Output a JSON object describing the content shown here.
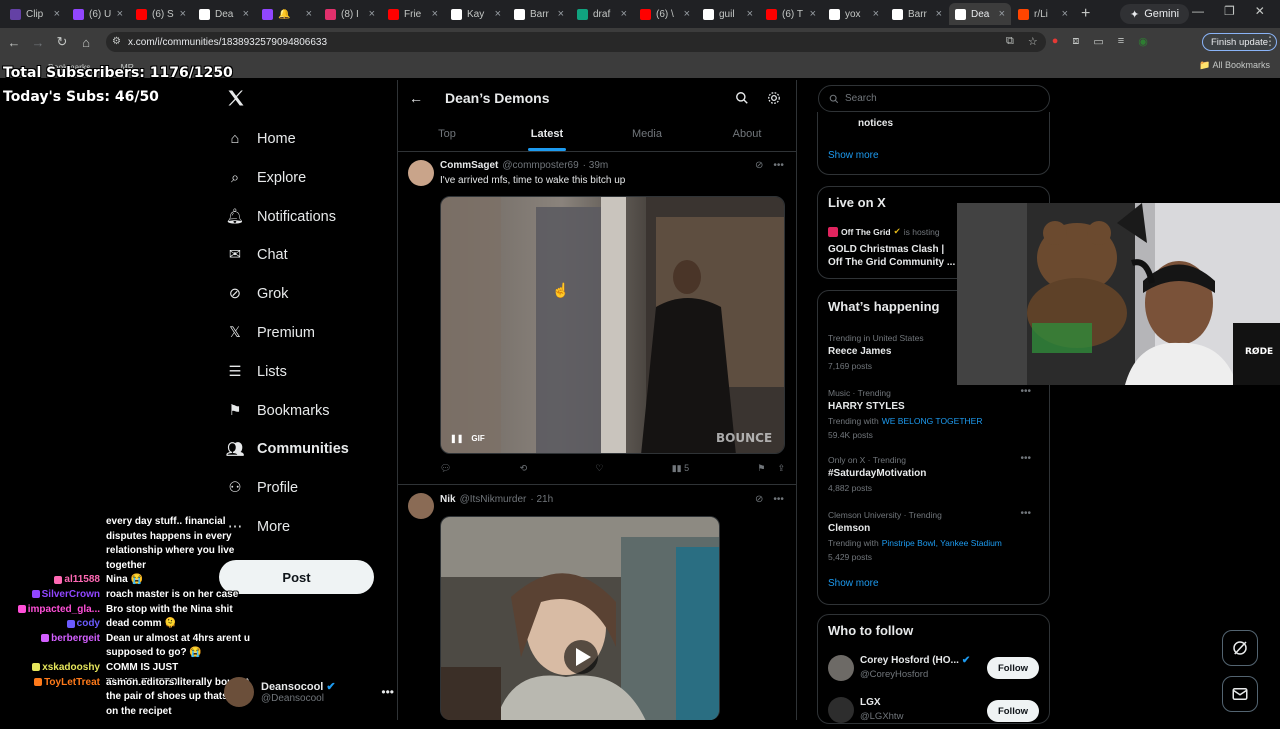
{
  "browser": {
    "tabs": [
      {
        "label": "Clip",
        "color": "#6441a5"
      },
      {
        "label": "(6) U",
        "color": "#9146ff"
      },
      {
        "label": "(6) S",
        "color": "#ff0000"
      },
      {
        "label": "Dea",
        "color": "#ffffff"
      },
      {
        "label": "🔔",
        "color": "#9146ff"
      },
      {
        "label": "(8) I",
        "color": "#e1306c"
      },
      {
        "label": "Frie",
        "color": "#ff0000"
      },
      {
        "label": "Kay",
        "color": "#ffffff"
      },
      {
        "label": "Barr",
        "color": "#ffffff"
      },
      {
        "label": "draf",
        "color": "#10a37f"
      },
      {
        "label": "(6) \\",
        "color": "#ff0000"
      },
      {
        "label": "guil",
        "color": "#ffffff"
      },
      {
        "label": "(6) T",
        "color": "#ff0000"
      },
      {
        "label": "yox",
        "color": "#ffffff"
      },
      {
        "label": "Barr",
        "color": "#ffffff"
      },
      {
        "label": "Dea",
        "color": "#ffffff",
        "active": true
      },
      {
        "label": "r/Li",
        "color": "#ff4500"
      }
    ],
    "gemini_label": "Gemini",
    "url": "x.com/i/communities/1838932579094806633",
    "update_label": "Finish update",
    "bookmarks_label": "Bookmarks",
    "bookmark_items": [
      "w",
      "MR"
    ],
    "all_bookmarks_label": "All Bookmarks"
  },
  "overlay": {
    "total_subs": "Total Subscribers: 1176/1250",
    "today_subs": "Today's Subs: 46/50"
  },
  "nav": {
    "items": [
      {
        "label": "Home",
        "icon": "home-icon"
      },
      {
        "label": "Explore",
        "icon": "search-icon"
      },
      {
        "label": "Notifications",
        "icon": "bell-icon"
      },
      {
        "label": "Chat",
        "icon": "mail-icon"
      },
      {
        "label": "Grok",
        "icon": "grok-icon"
      },
      {
        "label": "Premium",
        "icon": "x-icon"
      },
      {
        "label": "Lists",
        "icon": "list-icon"
      },
      {
        "label": "Bookmarks",
        "icon": "bookmark-icon"
      },
      {
        "label": "Communities",
        "icon": "people-icon",
        "active": true
      },
      {
        "label": "Profile",
        "icon": "person-icon"
      },
      {
        "label": "More",
        "icon": "more-circle-icon"
      }
    ],
    "post_label": "Post",
    "account_name": "Deansocool",
    "account_handle": "@Deansocool"
  },
  "chat": [
    {
      "user": "",
      "color": "#ffffff",
      "msg": "every day stuff.. financial"
    },
    {
      "user": "",
      "color": "#ffffff",
      "msg": "disputes happens in every"
    },
    {
      "user": "",
      "color": "#ffffff",
      "msg": "relationship where you live"
    },
    {
      "user": "",
      "color": "#ffffff",
      "msg": "together"
    },
    {
      "user": "al11588",
      "color": "#ff69b4",
      "msg": "Nina 😭"
    },
    {
      "user": "SilverCrown",
      "color": "#9146ff",
      "msg": "roach master is on her case"
    },
    {
      "user": "impacted_gla...",
      "color": "#ff4fd8",
      "msg": "Bro stop with the Nina shit"
    },
    {
      "user": "cody",
      "color": "#6b5bff",
      "msg": "dead comm 🫠"
    },
    {
      "user": "berbergeit",
      "color": "#d35fff",
      "msg": "Dean ur almost at 4hrs arent u"
    },
    {
      "user": "",
      "color": "#ffffff",
      "msg": "supposed to go? 😭"
    },
    {
      "user": "xskadooshy",
      "color": "#e6e65c",
      "msg": "COMM IS JUST TUMBLEWEEDS"
    },
    {
      "user": "ToyLetTreat",
      "color": "#ff7a1a",
      "msg": "asmon editors literally bought"
    },
    {
      "user": "",
      "color": "#ffffff",
      "msg": "the pair of shoes up thats not"
    },
    {
      "user": "",
      "color": "#ffffff",
      "msg": "on the recipet"
    }
  ],
  "community": {
    "title": "Dean’s Demons",
    "tabs": [
      "Top",
      "Latest",
      "Media",
      "About"
    ],
    "active_tab": "Latest"
  },
  "tweets": [
    {
      "name": "CommSaget",
      "handle": "@commposter69",
      "time": "· 39m",
      "text": "I've arrived mfs, time to wake this bitch up",
      "media_badge": "GIF",
      "watermark": "BOUNCE",
      "views": "5"
    },
    {
      "name": "Nik",
      "handle": "@ItsNikmurder",
      "time": "· 21h",
      "text": ""
    }
  ],
  "sidebar": {
    "search_placeholder": "Search",
    "notices_label": "notices",
    "show_more": "Show more",
    "live_title": "Live on X",
    "live_host": "Off The Grid",
    "live_hosting": "is hosting",
    "live_event": "GOLD Christmas Clash | Off The Grid Community ...",
    "happening_title": "What’s happening",
    "trends": [
      {
        "context": "Trending in United States",
        "name": "Reece James",
        "meta": "7,169 posts",
        "with": ""
      },
      {
        "context": "Music · Trending",
        "name": "HARRY STYLES",
        "meta": "59.4K posts",
        "with": "WE BELONG TOGETHER"
      },
      {
        "context": "Only on X · Trending",
        "name": "#SaturdayMotivation",
        "meta": "4,882 posts",
        "with": ""
      },
      {
        "context": "Clemson University · Trending",
        "name": "Clemson",
        "meta": "5,429 posts",
        "with": "Pinstripe Bowl, Yankee Stadium"
      }
    ],
    "trending_with_label": "Trending with",
    "who_title": "Who to follow",
    "follow_suggestions": [
      {
        "name": "Corey Hosford (HO...",
        "handle": "@CoreyHosford",
        "verified": true
      },
      {
        "name": "LGX",
        "handle": "@LGXhtw",
        "verified": false
      }
    ],
    "follow_label": "Follow"
  },
  "webcam": {
    "mic_brand": "RØDE"
  }
}
